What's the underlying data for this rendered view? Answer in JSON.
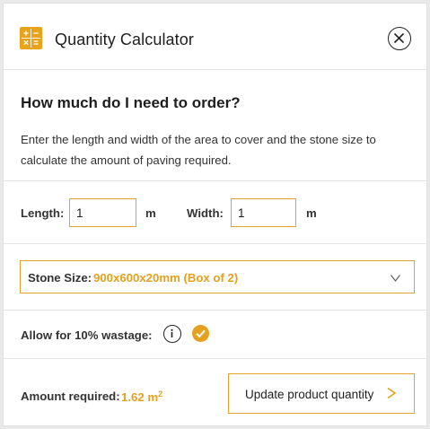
{
  "header": {
    "title": "Quantity Calculator",
    "icon": "calculator-icon",
    "close_icon": "close-icon"
  },
  "intro": {
    "heading": "How much do I need to order?",
    "description": "Enter the length and width of the area to cover and the stone size to calculate the amount of paving required."
  },
  "dimensions": {
    "length_label": "Length:",
    "length_value": "1",
    "length_unit": "m",
    "width_label": "Width:",
    "width_value": "1",
    "width_unit": "m"
  },
  "stone": {
    "label": "Stone Size:",
    "selected": "900x600x20mm (Box of 2)",
    "chevron_icon": "chevron-down-icon"
  },
  "wastage": {
    "label": "Allow for 10% wastage:",
    "info_icon": "info-icon",
    "checked": true
  },
  "footer": {
    "amount_label": "Amount required:",
    "amount_value": "1.62 m",
    "amount_unit_power": "2",
    "update_button": "Update product quantity",
    "update_arrow": ">"
  },
  "colors": {
    "accent": "#e3a11e",
    "border_accent": "#e0a42b",
    "text": "#222222"
  }
}
